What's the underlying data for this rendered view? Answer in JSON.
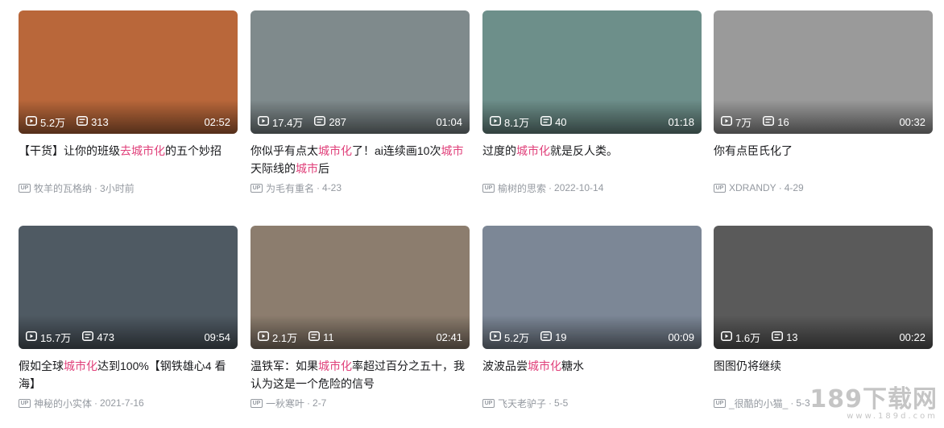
{
  "colors": {
    "highlight": "#e0407a",
    "meta": "#9499a0",
    "title": "#18191c"
  },
  "videos": [
    {
      "thumb_label": "thumbnail",
      "thumb_color": "#b9673a",
      "views": "5.2万",
      "danmaku": "313",
      "duration": "02:52",
      "title_parts": [
        [
          "【干货】让你的班级",
          false
        ],
        [
          "去城市化",
          true
        ],
        [
          "的五个妙招",
          false
        ]
      ],
      "author": "牧羊的瓦格纳",
      "date": "3小时前"
    },
    {
      "thumb_label": "thumbnail",
      "thumb_color": "#7f8a8c",
      "views": "17.4万",
      "danmaku": "287",
      "duration": "01:04",
      "title_parts": [
        [
          "你似乎有点太",
          false
        ],
        [
          "城市化",
          true
        ],
        [
          "了！ai连续画10次",
          false
        ],
        [
          "城市",
          true
        ],
        [
          "天际线的",
          false
        ],
        [
          "城市",
          true
        ],
        [
          "后",
          false
        ]
      ],
      "author": "为毛有重名",
      "date": "4-23"
    },
    {
      "thumb_label": "thumbnail",
      "thumb_color": "#6d8f8a",
      "views": "8.1万",
      "danmaku": "40",
      "duration": "01:18",
      "title_parts": [
        [
          "过度的",
          false
        ],
        [
          "城市化",
          true
        ],
        [
          "就是反人类。",
          false
        ]
      ],
      "author": "榆树的思索",
      "date": "2022-10-14"
    },
    {
      "thumb_label": "thumbnail",
      "thumb_color": "#9a9a9a",
      "views": "7万",
      "danmaku": "16",
      "duration": "00:32",
      "title_parts": [
        [
          "你有点臣氏化了",
          false
        ]
      ],
      "author": "XDRANDY",
      "date": "4-29"
    },
    {
      "thumb_label": "thumbnail",
      "thumb_color": "#4f5a63",
      "views": "15.7万",
      "danmaku": "473",
      "duration": "09:54",
      "title_parts": [
        [
          "假如全球",
          false
        ],
        [
          "城市化",
          true
        ],
        [
          "达到100%【钢铁雄心4 看海】",
          false
        ]
      ],
      "author": "神秘的小实体",
      "date": "2021-7-16"
    },
    {
      "thumb_label": "thumbnail",
      "thumb_color": "#8c7d6e",
      "views": "2.1万",
      "danmaku": "11",
      "duration": "02:41",
      "title_parts": [
        [
          "温铁军：如果",
          false
        ],
        [
          "城市化",
          true
        ],
        [
          "率超过百分之五十，我认为这是一个危险的信号",
          false
        ]
      ],
      "author": "一秋寒叶",
      "date": "2-7"
    },
    {
      "thumb_label": "thumbnail",
      "thumb_color": "#7c8796",
      "views": "5.2万",
      "danmaku": "19",
      "duration": "00:09",
      "title_parts": [
        [
          "波波品尝",
          false
        ],
        [
          "城市化",
          true
        ],
        [
          "糖水",
          false
        ]
      ],
      "author": "飞天老驴子",
      "date": "5-5"
    },
    {
      "thumb_label": "thumbnail",
      "thumb_color": "#5a5a5a",
      "views": "1.6万",
      "danmaku": "13",
      "duration": "00:22",
      "title_parts": [
        [
          "图图仍将继续",
          false
        ]
      ],
      "author": "_很酷的小猫_",
      "date": "5-3"
    }
  ],
  "up_badge": "UP",
  "watermark": {
    "main": "189下载网",
    "sub": "www.189d.com"
  }
}
